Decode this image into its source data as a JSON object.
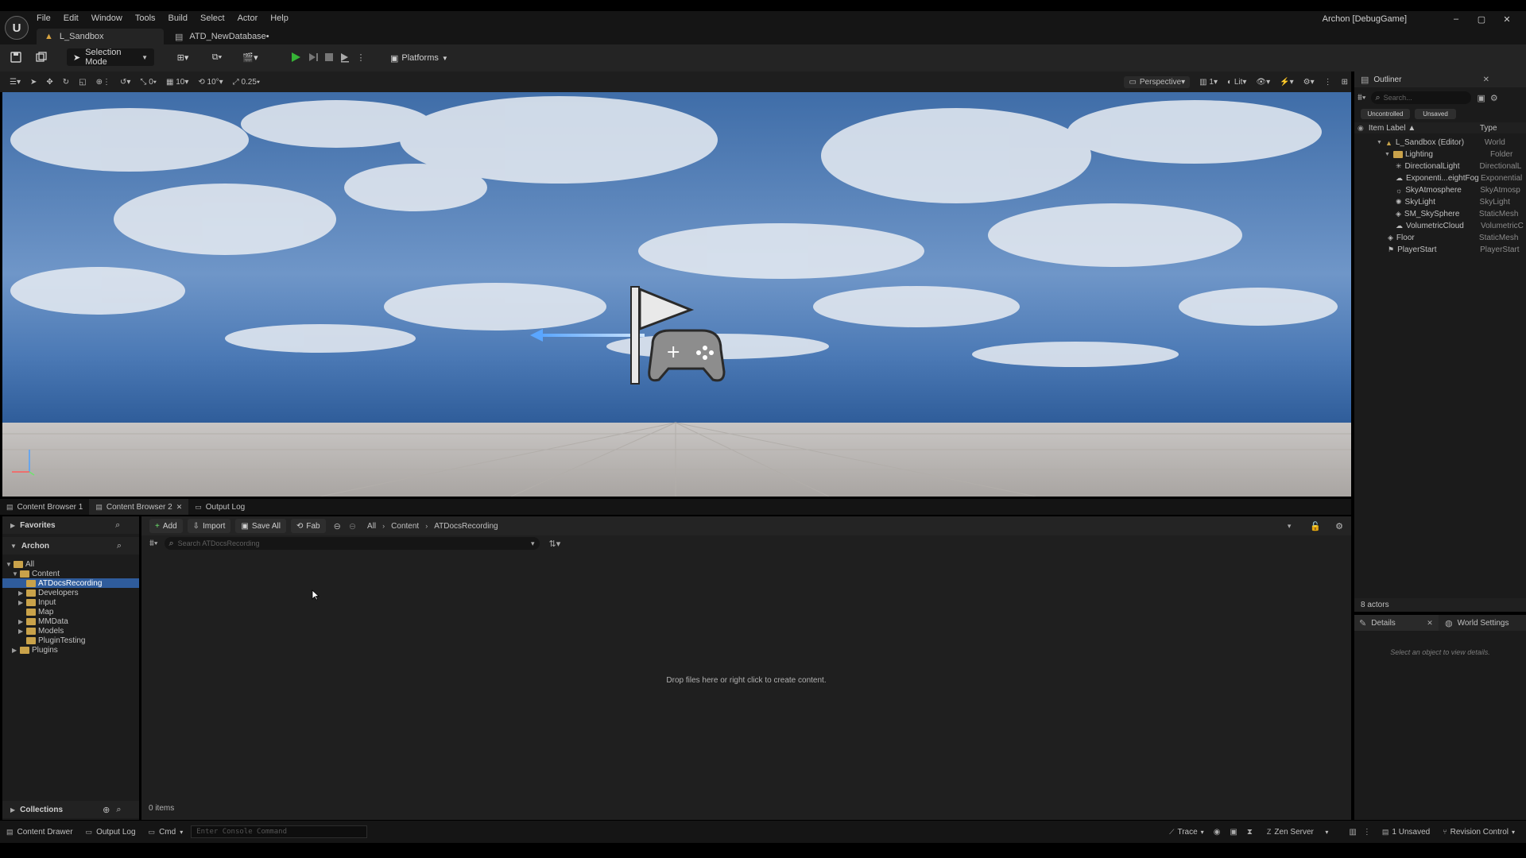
{
  "menu": [
    "File",
    "Edit",
    "Window",
    "Tools",
    "Build",
    "Select",
    "Actor",
    "Help"
  ],
  "logo": "U",
  "tabs": {
    "level": "L_Sandbox",
    "database": "ATD_NewDatabase•"
  },
  "project": "Archon [DebugGame]",
  "window_controls": [
    "–",
    "▢",
    "✕"
  ],
  "toolbar": {
    "selection_mode": "Selection Mode",
    "platforms": "Platforms"
  },
  "viewport_toolbar": {
    "rotate_snap": "0",
    "grid_snap": "10",
    "angle_snap": "10°",
    "scale_snap": "0.25",
    "perspective": "Perspective",
    "layouts": "1",
    "lit": "Lit"
  },
  "outliner": {
    "title": "Outliner",
    "search_placeholder": "Search...",
    "filters": [
      "Uncontrolled",
      "Unsaved"
    ],
    "col_label": "Item Label ▲",
    "col_type": "Type",
    "rows": [
      {
        "label": "L_Sandbox (Editor)",
        "type": "World"
      },
      {
        "label": "Lighting",
        "type": "Folder"
      },
      {
        "label": "DirectionalLight",
        "type": "DirectionalL"
      },
      {
        "label": "Exponenti...eightFog",
        "type": "Exponential"
      },
      {
        "label": "SkyAtmosphere",
        "type": "SkyAtmosp"
      },
      {
        "label": "SkyLight",
        "type": "SkyLight"
      },
      {
        "label": "SM_SkySphere",
        "type": "StaticMesh"
      },
      {
        "label": "VolumetricCloud",
        "type": "VolumetricC"
      },
      {
        "label": "Floor",
        "type": "StaticMesh"
      },
      {
        "label": "PlayerStart",
        "type": "PlayerStart"
      }
    ],
    "actor_count": "8 actors"
  },
  "details": {
    "tab_details": "Details",
    "tab_world": "World Settings",
    "empty": "Select an object to view details."
  },
  "bottom_tabs": [
    "Content Browser 1",
    "Content Browser 2",
    "Output Log"
  ],
  "sidebar": {
    "favorites": "Favorites",
    "project": "Archon",
    "tree": [
      {
        "label": "All",
        "depth": 0
      },
      {
        "label": "Content",
        "depth": 1
      },
      {
        "label": "ATDocsRecording",
        "depth": 2
      },
      {
        "label": "Developers",
        "depth": 2
      },
      {
        "label": "Input",
        "depth": 2
      },
      {
        "label": "Map",
        "depth": 2
      },
      {
        "label": "MMData",
        "depth": 2
      },
      {
        "label": "Models",
        "depth": 2
      },
      {
        "label": "PluginTesting",
        "depth": 2
      },
      {
        "label": "Plugins",
        "depth": 1
      }
    ],
    "collections": "Collections"
  },
  "content": {
    "add": "Add",
    "import": "Import",
    "save_all": "Save All",
    "fab": "Fab",
    "path": [
      "All",
      "Content",
      "ATDocsRecording"
    ],
    "search_placeholder": "Search ATDocsRecording",
    "empty_message": "Drop files here or right click to create content.",
    "items_count": "0 items"
  },
  "status": {
    "content_drawer": "Content Drawer",
    "output_log": "Output Log",
    "cmd": "Cmd",
    "console_placeholder": "Enter Console Command",
    "trace": "Trace",
    "zen": "Zen Server",
    "unsaved": "1 Unsaved",
    "revision": "Revision Control"
  },
  "colors": {
    "accent": "#3b82f6",
    "play": "#36b336",
    "folder": "#c9a24a"
  }
}
